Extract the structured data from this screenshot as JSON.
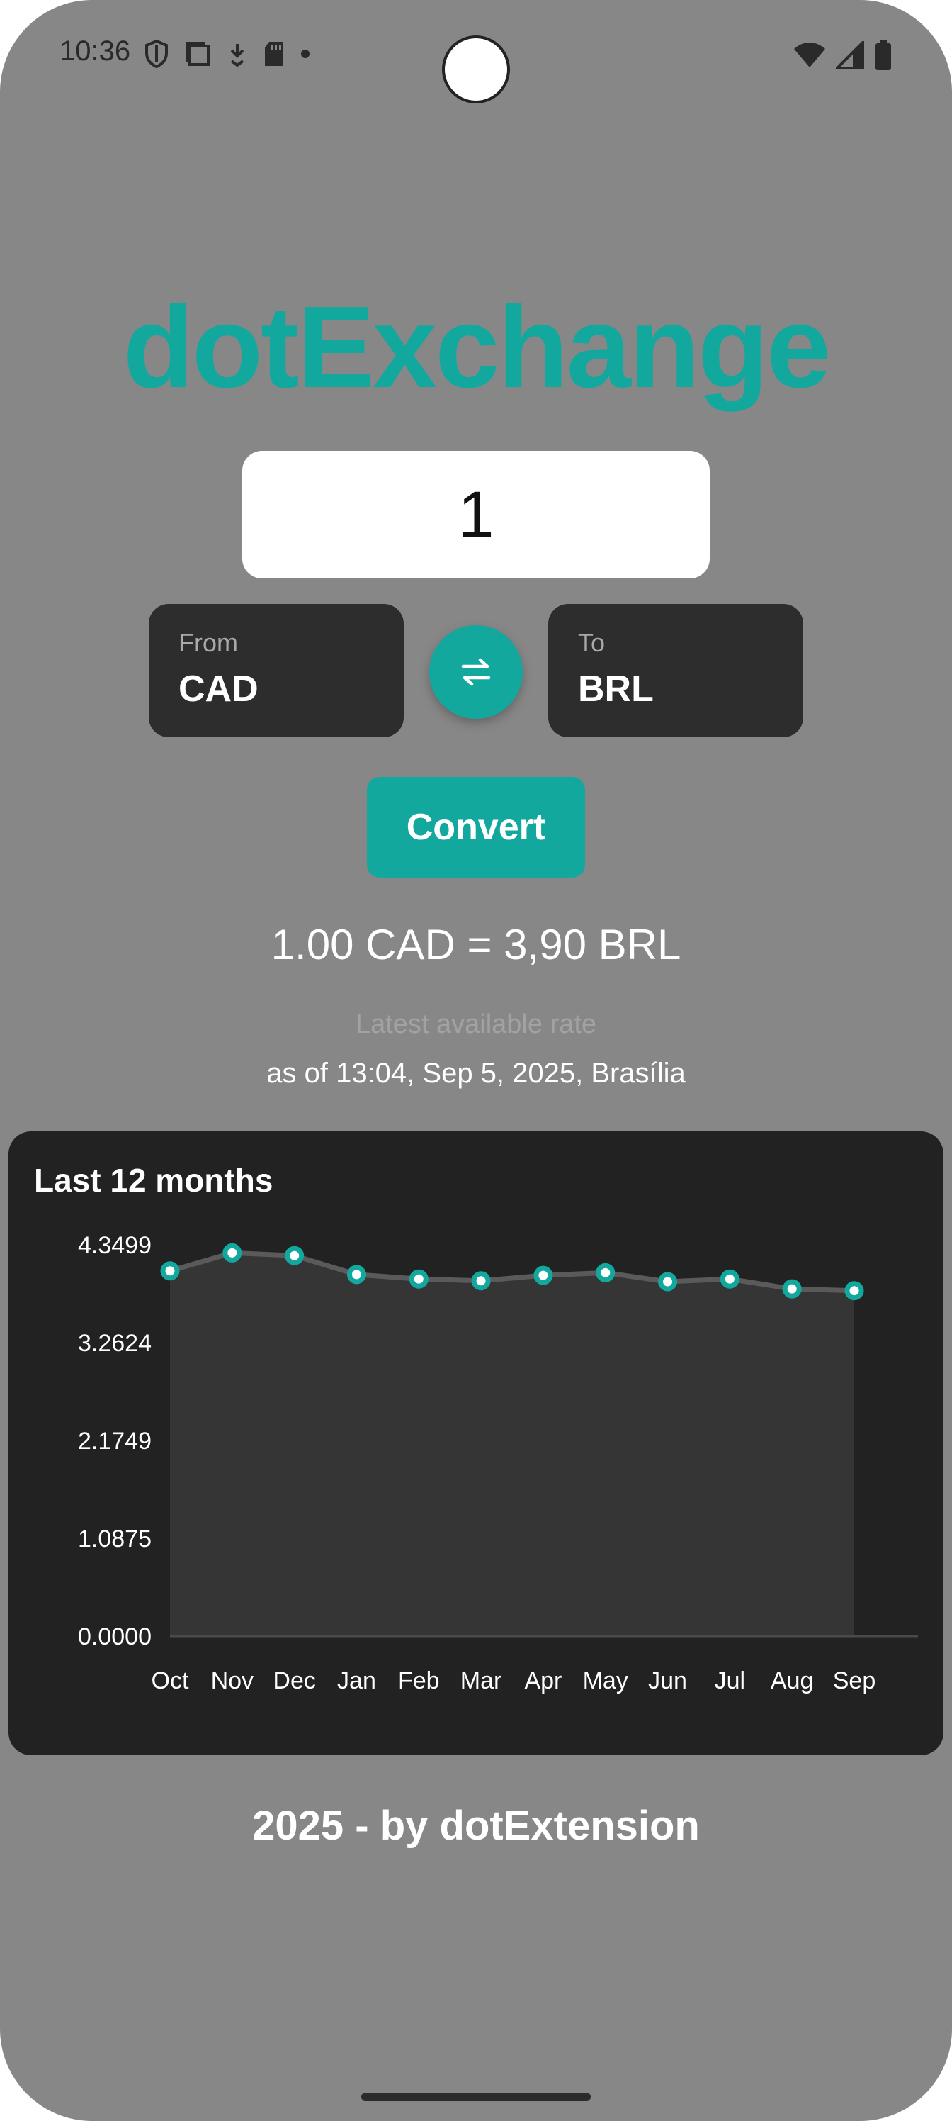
{
  "status_bar": {
    "time": "10:36"
  },
  "app": {
    "title": "dotExchange",
    "accent_color": "#13a89e"
  },
  "converter": {
    "amount_value": "1",
    "from_caption": "From",
    "from_currency": "CAD",
    "to_caption": "To",
    "to_currency": "BRL",
    "swap_icon": "swap-horizontal-icon",
    "convert_label": "Convert",
    "result": "1.00 CAD = 3,90 BRL",
    "rate_label": "Latest available rate",
    "rate_date": "as of 13:04, Sep 5, 2025, Brasília"
  },
  "chart_data": {
    "type": "area",
    "title": "Last 12 months",
    "categories": [
      "Oct",
      "Nov",
      "Dec",
      "Jan",
      "Feb",
      "Mar",
      "Apr",
      "May",
      "Jun",
      "Jul",
      "Aug",
      "Sep"
    ],
    "values": [
      4.06,
      4.26,
      4.23,
      4.02,
      3.97,
      3.95,
      4.01,
      4.04,
      3.94,
      3.97,
      3.86,
      3.84
    ],
    "y_ticks": [
      "4.3499",
      "3.2624",
      "2.1749",
      "1.0875",
      "0.0000"
    ],
    "ylim": [
      0,
      4.3499
    ],
    "line_color": "#5a5a5a",
    "point_color": "#13a89e",
    "fill_color": "#353535",
    "grid": false
  },
  "footer": {
    "text": "2025 - by dotExtension"
  }
}
